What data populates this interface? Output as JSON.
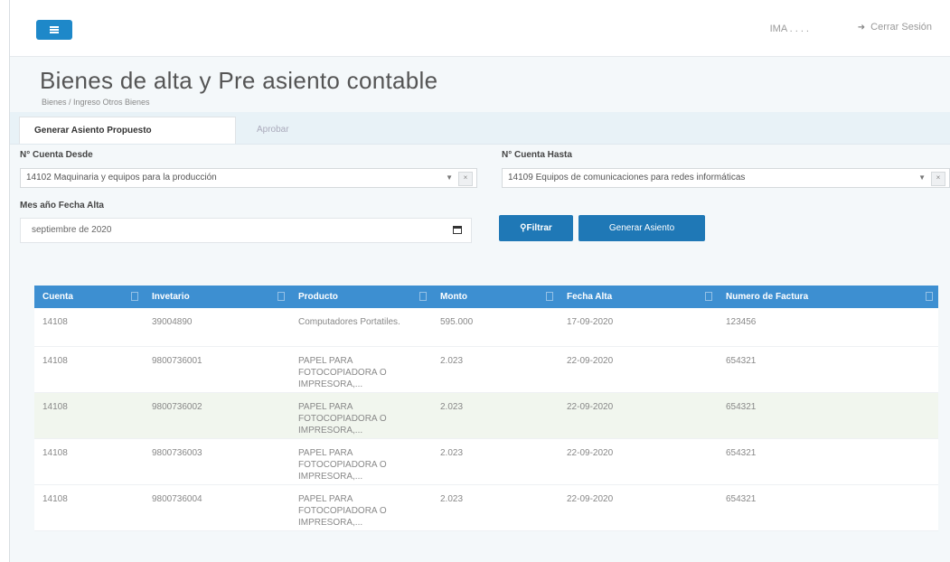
{
  "topbar": {
    "user_name": "IMA . . . .",
    "logout_label": "Cerrar Sesión"
  },
  "page": {
    "title": "Bienes de alta y Pre asiento contable",
    "breadcrumb": "Bienes / Ingreso Otros Bienes"
  },
  "tabs": {
    "active": "Generar Asiento Propuesto",
    "inactive": "Aprobar"
  },
  "filters": {
    "cuenta_desde": {
      "label": "N° Cuenta Desde",
      "value": "14102 Maquinaria y equipos para la producción"
    },
    "cuenta_hasta": {
      "label": "N° Cuenta Hasta",
      "value": "14109 Equipos de comunicaciones para redes informáticas"
    },
    "fecha_alta": {
      "label": "Mes año Fecha Alta",
      "value": "septiembre de 2020"
    },
    "filter_button": "Filtrar",
    "generate_button": "Generar Asiento"
  },
  "table": {
    "columns": [
      "Cuenta",
      "Invetario",
      "Producto",
      "Monto",
      "Fecha Alta",
      "Numero de Factura"
    ],
    "rows": [
      [
        "14108",
        "39004890",
        "Computadores Portatiles.",
        "595.000",
        "17-09-2020",
        "123456"
      ],
      [
        "14108",
        "9800736001",
        "PAPEL PARA FOTOCOPIADORA O IMPRESORA,...",
        "2.023",
        "22-09-2020",
        "654321"
      ],
      [
        "14108",
        "9800736002",
        "PAPEL PARA FOTOCOPIADORA O IMPRESORA,...",
        "2.023",
        "22-09-2020",
        "654321"
      ],
      [
        "14108",
        "9800736003",
        "PAPEL PARA FOTOCOPIADORA O IMPRESORA,...",
        "2.023",
        "22-09-2020",
        "654321"
      ],
      [
        "14108",
        "9800736004",
        "PAPEL PARA FOTOCOPIADORA O IMPRESORA,...",
        "2.023",
        "22-09-2020",
        "654321"
      ]
    ]
  },
  "colors": {
    "primary_button": "#1f78b6",
    "table_header": "#3d8fd1",
    "alt_row": "#f1f6ee"
  }
}
